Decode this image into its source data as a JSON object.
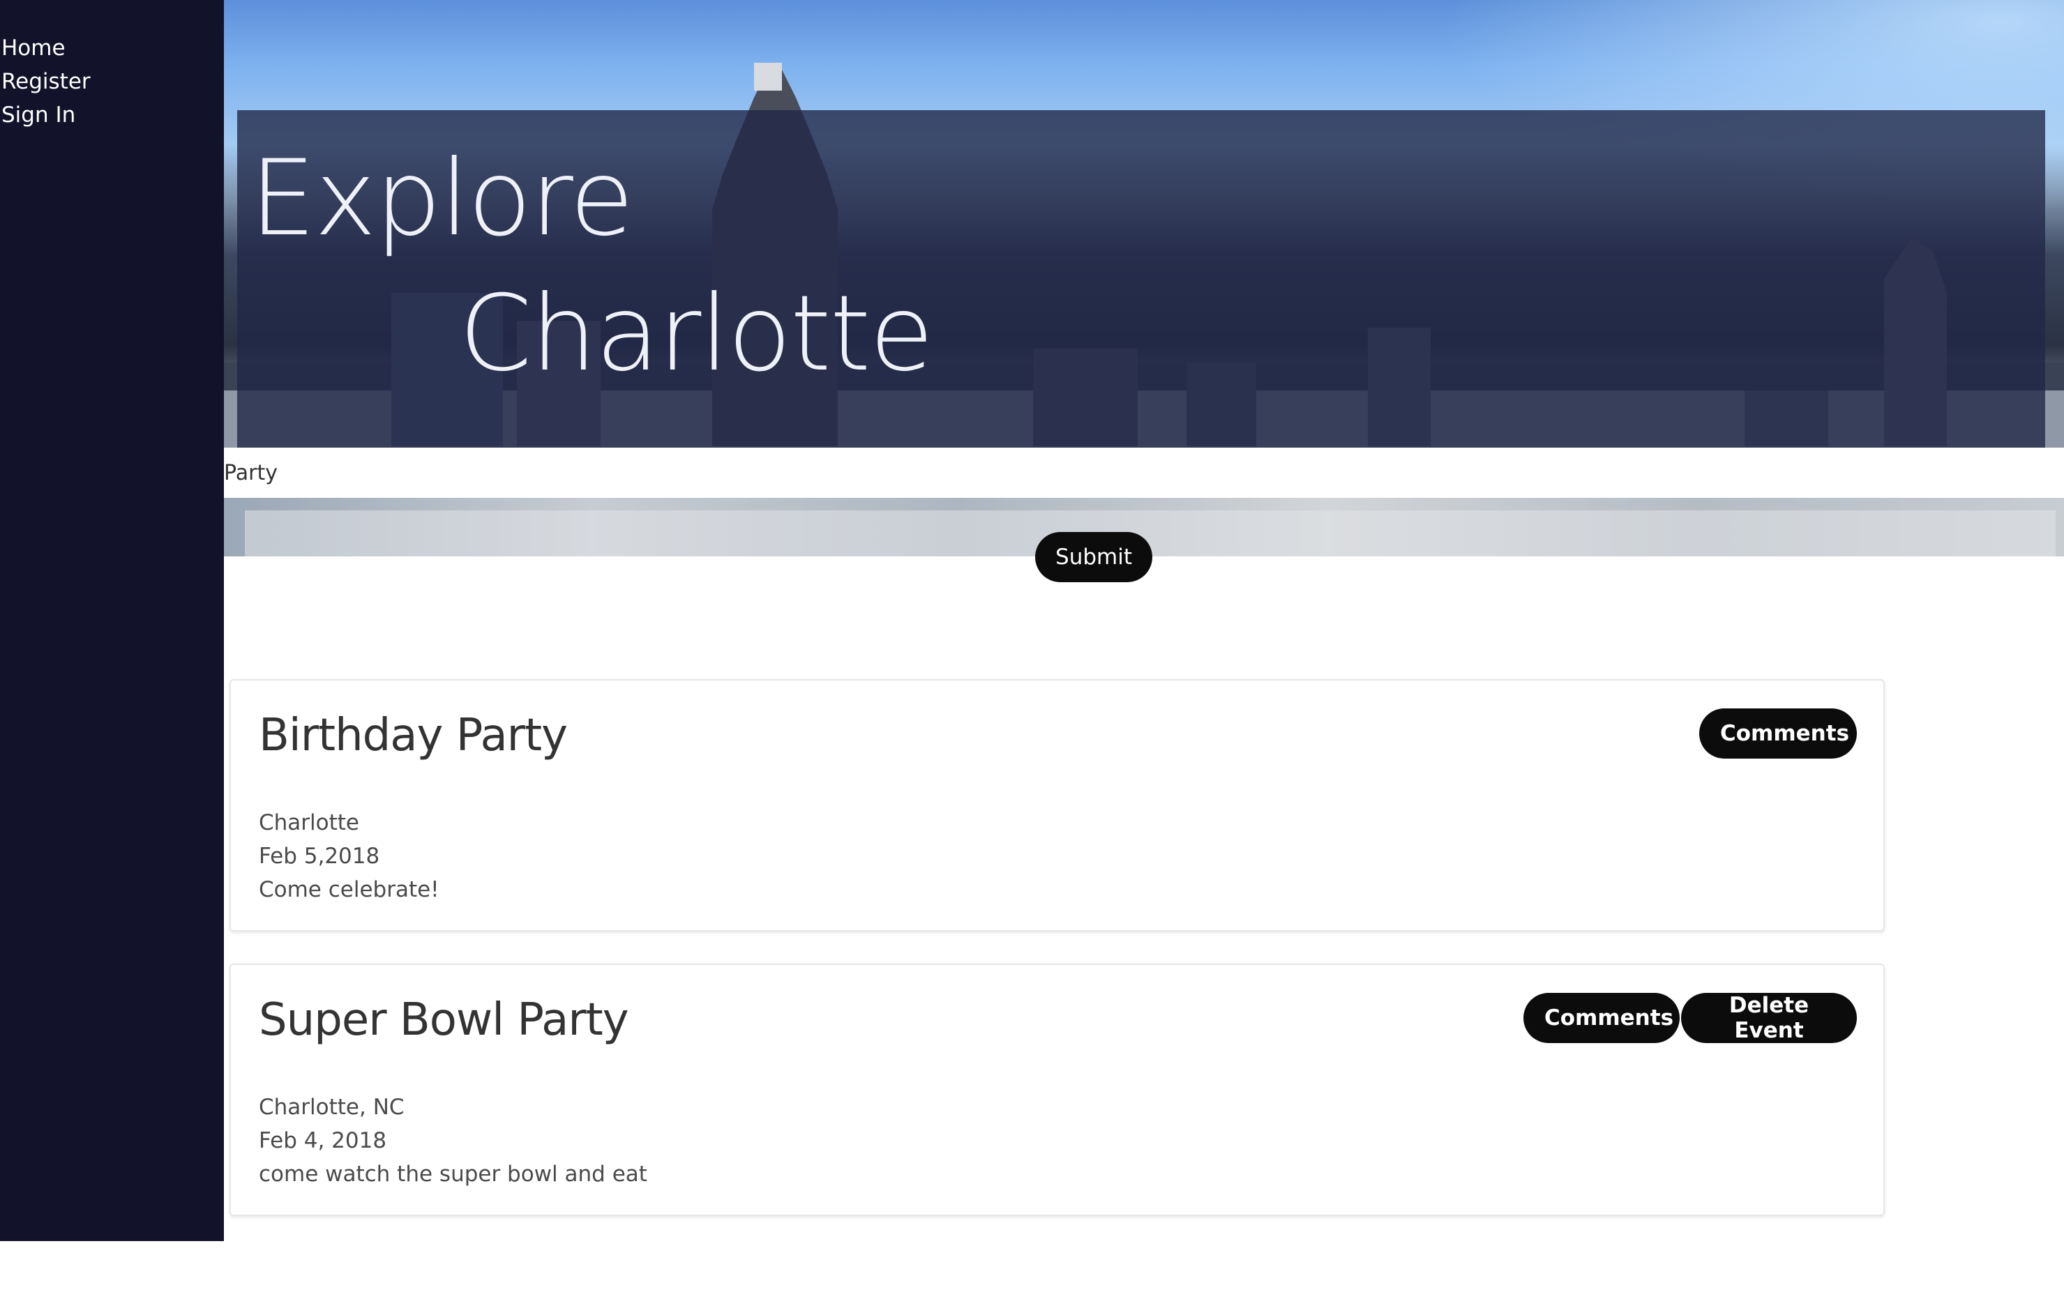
{
  "sidebar": {
    "items": [
      {
        "label": "Home"
      },
      {
        "label": "Register"
      },
      {
        "label": "Sign In"
      }
    ]
  },
  "hero": {
    "title_line1": "Explore",
    "title_line2": "Charlotte"
  },
  "search": {
    "value": "Party"
  },
  "submit_label": "Submit",
  "events": [
    {
      "title": "Birthday Party",
      "location": "Charlotte",
      "date": "Feb 5,2018",
      "description": "Come celebrate!",
      "comments_label": "Comments"
    },
    {
      "title": "Super Bowl Party",
      "location": "Charlotte, NC",
      "date": "Feb 4, 2018",
      "description": "come watch the super bowl and eat",
      "comments_label": "Comments",
      "delete_label": "Delete Event"
    }
  ],
  "colors": {
    "sidebar_bg": "#12122a",
    "button_bg": "#0c0c0c",
    "hero_overlay": "#202646"
  }
}
